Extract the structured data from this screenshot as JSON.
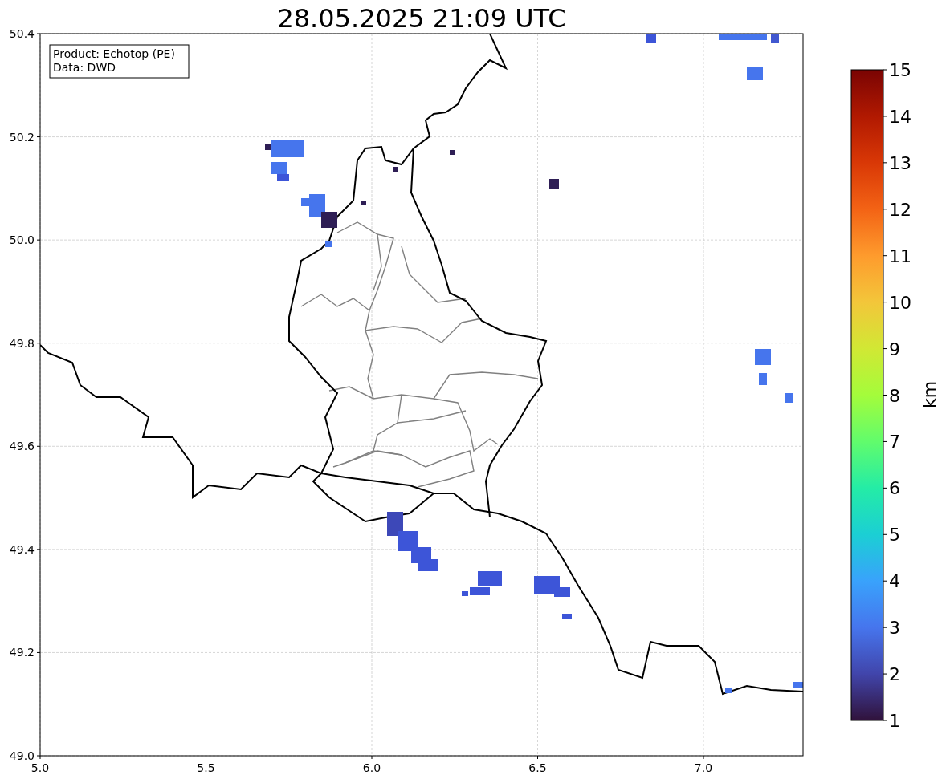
{
  "title": "28.05.2025 21:09 UTC",
  "legend": [
    "Product: Echotop (PE)",
    "Data: DWD"
  ],
  "x_axis": {
    "ticks": [
      "5.0",
      "5.5",
      "6.0",
      "6.5",
      "7.0"
    ]
  },
  "y_axis": {
    "ticks": [
      "50.4",
      "50.2",
      "50.0",
      "49.8",
      "49.6",
      "49.4",
      "49.2",
      "49.0"
    ]
  },
  "colorbar": {
    "label": "km",
    "ticks": [
      "15",
      "14",
      "13",
      "12",
      "11",
      "10",
      "9",
      "8",
      "7",
      "6",
      "5",
      "4",
      "3",
      "2",
      "1"
    ]
  }
}
